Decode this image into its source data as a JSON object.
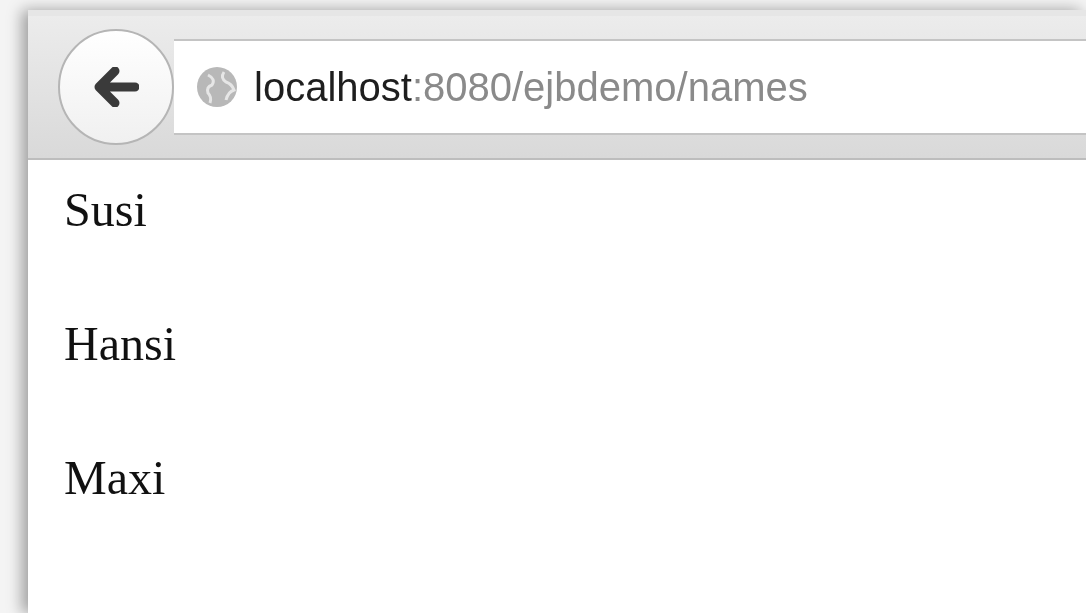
{
  "browser": {
    "url": {
      "host": "localhost",
      "path": ":8080/ejbdemo/names"
    }
  },
  "page": {
    "names": [
      "Susi",
      "Hansi",
      "Maxi"
    ]
  }
}
